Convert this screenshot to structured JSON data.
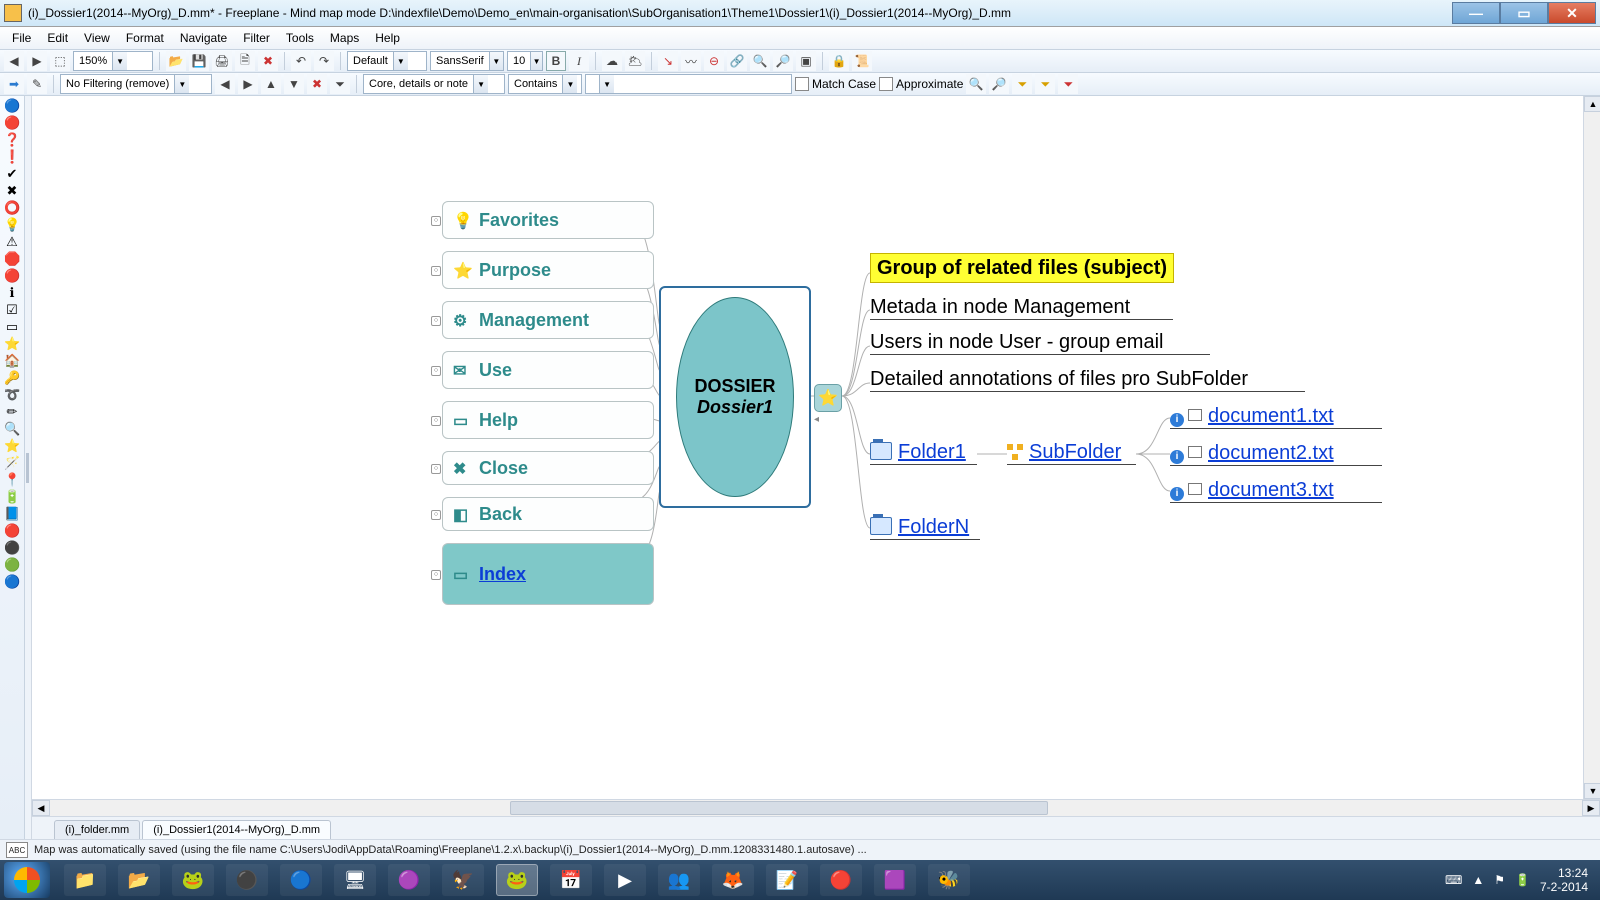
{
  "window": {
    "title": "(i)_Dossier1(2014--MyOrg)_D.mm* - Freeplane - Mind map mode D:\\indexfile\\Demo\\Demo_en\\main-organisation\\SubOrganisation1\\Theme1\\Dossier1\\(i)_Dossier1(2014--MyOrg)_D.mm"
  },
  "menu": [
    "File",
    "Edit",
    "View",
    "Format",
    "Navigate",
    "Filter",
    "Tools",
    "Maps",
    "Help"
  ],
  "toolbar1": {
    "zoom": "150%",
    "paragraph_style": "Default",
    "font_family": "SansSerif",
    "font_size": "10"
  },
  "toolbar2": {
    "filter_mode": "No Filtering (remove)",
    "search_in": "Core, details or note",
    "match": "Contains",
    "opt_matchcase": "Match Case",
    "opt_approx": "Approximate"
  },
  "root": {
    "line1": "DOSSIER",
    "line2": "Dossier1"
  },
  "left_nodes": [
    {
      "icon": "💡",
      "label": "Favorites"
    },
    {
      "icon": "⭐",
      "label": "Purpose"
    },
    {
      "icon": "⚙",
      "label": "Management"
    },
    {
      "icon": "✉",
      "label": "Use"
    },
    {
      "icon": "▭",
      "label": "Help"
    },
    {
      "icon": "✖",
      "label": "Close"
    },
    {
      "icon": "◧",
      "label": "Back"
    },
    {
      "icon": "▭",
      "label": "Index"
    }
  ],
  "right": {
    "highlight": "Group of related files (subject)",
    "lines": [
      "Metada in node Management",
      "Users in node User - group email",
      "Detailed annotations of files pro SubFolder"
    ],
    "folder1": "Folder1",
    "subfolder": "SubFolder",
    "folderN": "FolderN",
    "docs": [
      "document1.txt",
      "document2.txt",
      "document3.txt"
    ]
  },
  "tabs": [
    "(i)_folder.mm",
    "(i)_Dossier1(2014--MyOrg)_D.mm"
  ],
  "status": "Map was automatically saved (using the file name C:\\Users\\Jodi\\AppData\\Roaming\\Freeplane\\1.2.x\\.backup\\(i)_Dossier1(2014--MyOrg)_D.mm.1208331480.1.autosave) ...",
  "taskbar": {
    "time": "13:24",
    "date": "7-2-2014"
  },
  "sidebar_icons": [
    "🔵",
    "🔴",
    "❓",
    "❗",
    "✔",
    "✖",
    "⭕",
    "💡",
    "⚠",
    "🛑",
    "🔴",
    "ℹ",
    "☑",
    "▭",
    "⭐",
    "🏠",
    "🔑",
    "➰",
    "✏",
    "🔍",
    "⭐",
    "🪄",
    "📍",
    "🔋",
    "📘",
    "🔴",
    "⚫",
    "🟢",
    "🔵"
  ],
  "tb_items": [
    "📁",
    "📂",
    "🐸",
    "⚫",
    "🔵",
    "🖥",
    "🟣",
    "🦅",
    "🐸",
    "📅",
    "▶",
    "👥",
    "🦊",
    "📝",
    "🔴",
    "🟪",
    "🐝"
  ]
}
